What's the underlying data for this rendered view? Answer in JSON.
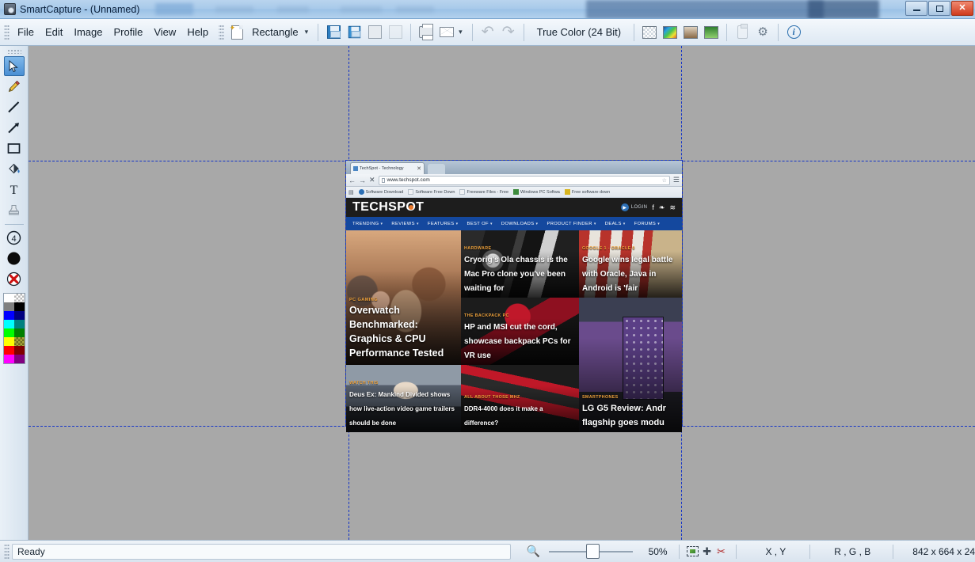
{
  "window": {
    "title": "SmartCapture - (Unnamed)",
    "app_icon": "camera-icon",
    "minimize_label": "",
    "maximize_label": "",
    "close_label": "✕"
  },
  "menubar": {
    "items": [
      {
        "label": "File"
      },
      {
        "label": "Edit"
      },
      {
        "label": "Image"
      },
      {
        "label": "Profile"
      },
      {
        "label": "View"
      },
      {
        "label": "Help"
      }
    ]
  },
  "toolbar": {
    "shape_tool": {
      "icon": "rectangle-region-icon",
      "label": "Rectangle",
      "caret": "▾"
    },
    "color_depth": "True Color (24 Bit)",
    "mail_caret": "▾",
    "buttons": [
      {
        "name": "save-button",
        "icon": "floppy-save-icon"
      },
      {
        "name": "save-all-button",
        "icon": "save-all-icon"
      },
      {
        "name": "copy-button",
        "icon": "copy-icon"
      },
      {
        "name": "paste-button",
        "icon": "paste-icon"
      },
      {
        "name": "print-button",
        "icon": "printer-icon"
      },
      {
        "name": "email-button",
        "icon": "envelope-icon"
      },
      {
        "name": "undo-button",
        "icon": "undo-arrow-icon"
      },
      {
        "name": "redo-button",
        "icon": "redo-arrow-icon"
      },
      {
        "name": "transparency-button",
        "icon": "checkerboard-image-icon"
      },
      {
        "name": "color-adjust-button",
        "icon": "rainbow-image-icon"
      },
      {
        "name": "sepia-button",
        "icon": "sepia-image-icon"
      },
      {
        "name": "effects-button",
        "icon": "green-image-icon"
      },
      {
        "name": "clipboard-text-button",
        "icon": "clipboard-icon"
      },
      {
        "name": "settings-button",
        "icon": "gear-icon"
      },
      {
        "name": "info-button",
        "icon": "info-icon"
      }
    ]
  },
  "palette": {
    "tools": [
      {
        "name": "select-tool",
        "icon": "cursor-arrow-icon",
        "active": true
      },
      {
        "name": "pencil-tool",
        "icon": "pencil-icon",
        "active": false
      },
      {
        "name": "line-tool",
        "icon": "line-icon",
        "active": false
      },
      {
        "name": "arrow-tool",
        "icon": "arrow-icon",
        "active": false
      },
      {
        "name": "rectangle-tool",
        "icon": "rectangle-icon",
        "active": false
      },
      {
        "name": "fill-tool",
        "icon": "paint-bucket-icon",
        "active": false
      },
      {
        "name": "text-tool",
        "icon": "text-t-icon",
        "active": false
      },
      {
        "name": "stamp-tool",
        "icon": "stamp-icon",
        "active": false
      },
      {
        "name": "number-tool",
        "icon": "numbered-circle-icon",
        "label": "4",
        "active": false
      },
      {
        "name": "ellipse-tool",
        "icon": "filled-circle-icon",
        "active": false
      },
      {
        "name": "delete-tool",
        "icon": "red-x-circle-icon",
        "active": false
      }
    ],
    "swatches": [
      "#ffffff",
      "#c8c8c8",
      "#808080",
      "#000000",
      "#0000ff",
      "#000080",
      "#00ffff",
      "#008080",
      "#00ff00",
      "#008000",
      "#ffff00",
      "#808000",
      "#ff0000",
      "#800000",
      "#ff00ff",
      "#800080"
    ]
  },
  "canvas": {
    "guides": {
      "vertical": [
        404,
        824
      ],
      "horizontal": [
        145,
        480
      ]
    }
  },
  "screenshot": {
    "browser": {
      "tab": {
        "title": "TechSpot - Technology",
        "close": "✕"
      },
      "back": "←",
      "forward": "→",
      "stop": "✕",
      "url": "www.techspot.com",
      "star": "☆",
      "bookmarks": [
        {
          "label": "Software Download",
          "color": "#2b6fb5"
        },
        {
          "label": "Software Free Down",
          "color": "#f0f2f5"
        },
        {
          "label": "Freeware Files - Free",
          "color": "#f0f2f5"
        },
        {
          "label": "Windows PC Softwa",
          "color": "#3d8b3d"
        },
        {
          "label": "Free software down",
          "color": "#d8b520"
        }
      ]
    },
    "site": {
      "logo_pre": "TECHSP",
      "logo_o": "O",
      "logo_post": "T",
      "login_label": "LOGIN",
      "play_icon": "▶",
      "social": [
        "f",
        "❧",
        "≋"
      ],
      "nav": [
        {
          "label": "TRENDING"
        },
        {
          "label": "REVIEWS"
        },
        {
          "label": "FEATURES"
        },
        {
          "label": "BEST OF"
        },
        {
          "label": "DOWNLOADS"
        },
        {
          "label": "PRODUCT FINDER"
        },
        {
          "label": "DEALS"
        },
        {
          "label": "FORUMS"
        }
      ],
      "articles": [
        {
          "kicker": "PC GAMING",
          "title": "Overwatch Benchmarked: Graphics & CPU Performance Tested",
          "art": "art-overwatch"
        },
        {
          "kicker": "HARDWARE",
          "title": "Cryorig's Ola chassis is the Mac Pro clone you've been waiting for",
          "art": "art-cryorig"
        },
        {
          "kicker": "GOOGLE 1 - ORACLE 0",
          "title": "Google wins legal battle with Oracle, Java in Android is 'fair",
          "art": "art-google"
        },
        {
          "kicker": "THE BACKPACK PC",
          "title": "HP and MSI cut the cord, showcase backpack PCs for VR use",
          "art": "art-backpack"
        },
        {
          "kicker": "SMARTPHONES",
          "title": "LG G5 Review: Andr flagship goes modu",
          "art": "art-lg"
        },
        {
          "kicker": "WATCH THIS",
          "title": "Deus Ex: Mankind Divided shows how live-action video game trailers should be done",
          "art": "art-deusex"
        },
        {
          "kicker": "ALL ABOUT THOSE MHZ",
          "title": "DDR4-4000 does it make a difference?",
          "art": "art-ddr4"
        }
      ]
    }
  },
  "statusbar": {
    "message": "Ready",
    "zoom_icon": "magnifier-icon",
    "zoom_level": "50%",
    "tools": [
      {
        "name": "marquee-icon"
      },
      {
        "name": "magic-wand-icon"
      },
      {
        "name": "scissors-icon"
      }
    ],
    "coordinates_label": "X , Y",
    "rgb_label": "R , G , B",
    "dimensions": "842 x 664 x 24"
  }
}
